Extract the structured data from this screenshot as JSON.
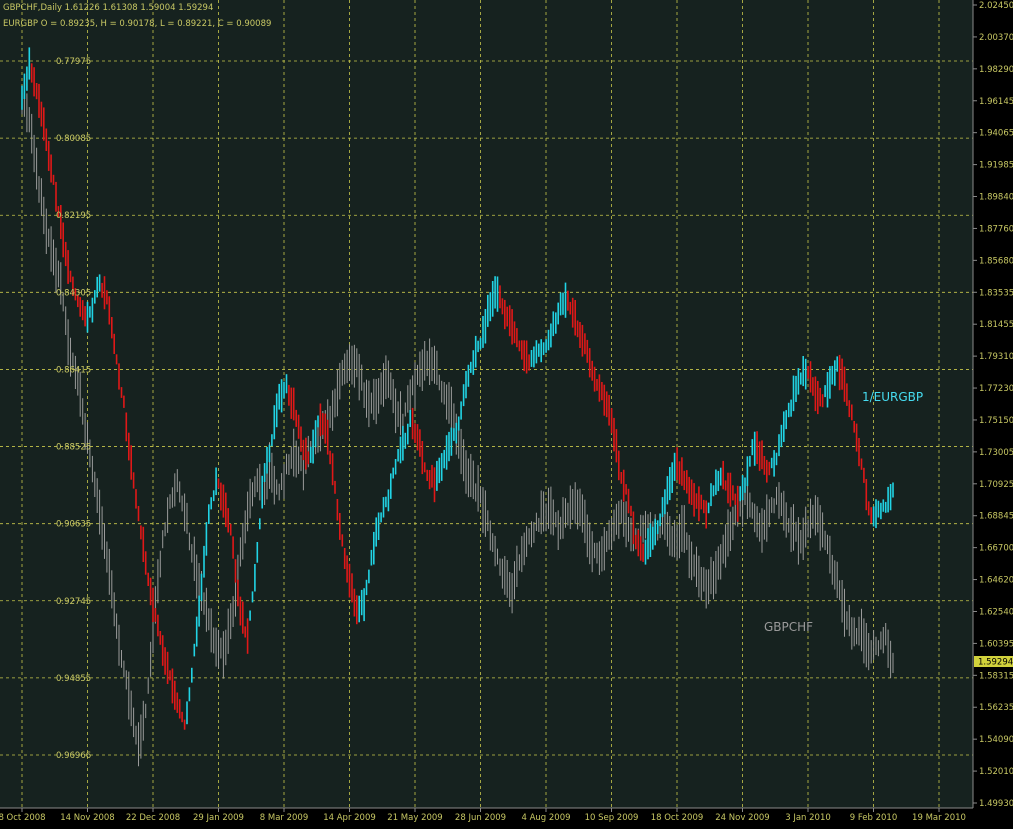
{
  "header": {
    "line1": "GBPCHF,Daily  1.61226 1.61308 1.59004 1.59294",
    "line2": "EURGBP O = 0.89235, H = 0.90178, L = 0.89221, C = 0.90089"
  },
  "colors": {
    "background": "#000000",
    "plot_background": "#16221f",
    "grid": "#c8c84b",
    "axis_text": "#c8c864",
    "bull": "#21d4e5",
    "bear": "#e01818",
    "gbpchf_line": "#9a9a9a",
    "label_eurgbp": "#46dcf0",
    "label_gbpchf": "#9a9a9a",
    "price_tag_bg": "#d2d23c"
  },
  "chart_data": {
    "type": "line",
    "x_tick_labels": [
      "8 Oct 2008",
      "14 Nov 2008",
      "22 Dec 2008",
      "29 Jan 2009",
      "8 Mar 2009",
      "14 Apr 2009",
      "21 May 2009",
      "28 Jun 2009",
      "4 Aug 2009",
      "10 Sep 2009",
      "18 Oct 2009",
      "24 Nov 2009",
      "3 Jan 2010",
      "9 Feb 2010",
      "19 Mar 2010"
    ],
    "y_right_ticks": [
      "2.02450",
      "2.00370",
      "1.98290",
      "1.96145",
      "1.94065",
      "1.91985",
      "1.89840",
      "1.87760",
      "1.85680",
      "1.83535",
      "1.81455",
      "1.79310",
      "1.77230",
      "1.75150",
      "1.73005",
      "1.70925",
      "1.68845",
      "1.66700",
      "1.64620",
      "1.62540",
      "1.60395",
      "1.58315",
      "1.56235",
      "1.54090",
      "1.52010",
      "1.49930"
    ],
    "y_left_ticks": [
      "0.77975",
      "0.80085",
      "0.82195",
      "0.84305",
      "0.86415",
      "0.88525",
      "0.90635",
      "0.92745",
      "0.94855",
      "0.96966"
    ],
    "y_right_range": [
      1.4993,
      2.0245
    ],
    "y_left_range": [
      0.77975,
      0.96966
    ],
    "current_price": "1.59294",
    "grid": true,
    "series": [
      {
        "name": "1/EURGBP",
        "axis": "left",
        "values": [
          0.79,
          0.78,
          0.788,
          0.8,
          0.812,
          0.825,
          0.836,
          0.845,
          0.85,
          0.848,
          0.84,
          0.845,
          0.86,
          0.872,
          0.89,
          0.905,
          0.918,
          0.93,
          0.94,
          0.948,
          0.955,
          0.962,
          0.945,
          0.925,
          0.905,
          0.895,
          0.9,
          0.91,
          0.93,
          0.938,
          0.92,
          0.895,
          0.885,
          0.873,
          0.868,
          0.875,
          0.885,
          0.89,
          0.878,
          0.88,
          0.892,
          0.91,
          0.92,
          0.93,
          0.928,
          0.915,
          0.905,
          0.9,
          0.89,
          0.885,
          0.878,
          0.883,
          0.893,
          0.895,
          0.89,
          0.884,
          0.88,
          0.87,
          0.862,
          0.856,
          0.848,
          0.843,
          0.848,
          0.852,
          0.858,
          0.862,
          0.86,
          0.858,
          0.855,
          0.848,
          0.845,
          0.85,
          0.855,
          0.862,
          0.868,
          0.872,
          0.88,
          0.893,
          0.9,
          0.912,
          0.915,
          0.91,
          0.905,
          0.898,
          0.89,
          0.893,
          0.898,
          0.9,
          0.903,
          0.897,
          0.893,
          0.897,
          0.9,
          0.895,
          0.885,
          0.888,
          0.892,
          0.888,
          0.88,
          0.873,
          0.866,
          0.864,
          0.87,
          0.873,
          0.866,
          0.863,
          0.87,
          0.88,
          0.89,
          0.905,
          0.903,
          0.902,
          0.898
        ]
      },
      {
        "name": "GBPCHF",
        "axis": "right",
        "values": [
          1.96,
          1.95,
          1.91,
          1.88,
          1.86,
          1.84,
          1.8,
          1.78,
          1.75,
          1.72,
          1.69,
          1.66,
          1.62,
          1.59,
          1.56,
          1.54,
          1.56,
          1.62,
          1.67,
          1.7,
          1.71,
          1.69,
          1.66,
          1.64,
          1.62,
          1.6,
          1.6,
          1.62,
          1.66,
          1.69,
          1.71,
          1.71,
          1.72,
          1.7,
          1.72,
          1.73,
          1.72,
          1.73,
          1.74,
          1.75,
          1.76,
          1.78,
          1.79,
          1.79,
          1.77,
          1.76,
          1.77,
          1.78,
          1.76,
          1.75,
          1.77,
          1.78,
          1.79,
          1.79,
          1.77,
          1.76,
          1.74,
          1.72,
          1.71,
          1.7,
          1.68,
          1.66,
          1.65,
          1.64,
          1.66,
          1.67,
          1.68,
          1.69,
          1.69,
          1.68,
          1.69,
          1.7,
          1.69,
          1.67,
          1.66,
          1.67,
          1.68,
          1.69,
          1.68,
          1.67,
          1.68,
          1.68,
          1.68,
          1.68,
          1.67,
          1.68,
          1.66,
          1.65,
          1.64,
          1.65,
          1.66,
          1.68,
          1.69,
          1.7,
          1.69,
          1.68,
          1.69,
          1.7,
          1.69,
          1.68,
          1.67,
          1.68,
          1.69,
          1.68,
          1.66,
          1.64,
          1.62,
          1.61,
          1.61,
          1.6,
          1.6,
          1.61,
          1.59
        ]
      }
    ],
    "series_labels": {
      "eurgbp": "1/EURGBP",
      "gbpchf": "GBPCHF"
    }
  }
}
